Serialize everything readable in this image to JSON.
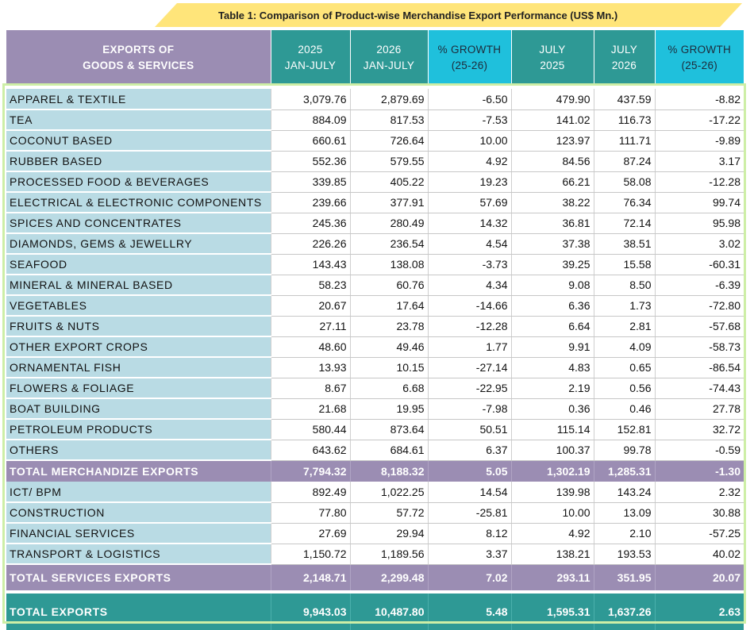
{
  "title": "Table 1: Comparison of Product-wise Merchandise Export Performance (US$ Mn.)",
  "colors": {
    "banner": "#ffe57a",
    "label_header": "#9b8db3",
    "teal": "#2e9995",
    "cyan": "#1fc0dc",
    "row_label": "#b9dbe4",
    "frame": "#cdeea6"
  },
  "headers": {
    "label_line1": "EXPORTS OF",
    "label_line2": "GOODS & SERVICES",
    "c1_line1": "2025",
    "c1_line2": "JAN-JULY",
    "c2_line1": "2026",
    "c2_line2": "JAN-JULY",
    "c3_line1": "% GROWTH",
    "c3_line2": "(25-26)",
    "c4_line1": "JULY",
    "c4_line2": "2025",
    "c5_line1": "JULY",
    "c5_line2": "2026",
    "c6_line1": "% GROWTH",
    "c6_line2": "(25-26)"
  },
  "merchandise": [
    [
      "APPAREL & TEXTILE",
      "3,079.76",
      "2,879.69",
      "-6.50",
      "479.90",
      "437.59",
      "-8.82"
    ],
    [
      "TEA",
      "884.09",
      "817.53",
      "-7.53",
      "141.02",
      "116.73",
      "-17.22"
    ],
    [
      "COCONUT BASED",
      "660.61",
      "726.64",
      "10.00",
      "123.97",
      "111.71",
      "-9.89"
    ],
    [
      "RUBBER BASED",
      "552.36",
      "579.55",
      "4.92",
      "84.56",
      "87.24",
      "3.17"
    ],
    [
      "PROCESSED FOOD & BEVERAGES",
      "339.85",
      "405.22",
      "19.23",
      "66.21",
      "58.08",
      "-12.28"
    ],
    [
      "ELECTRICAL & ELECTRONIC   COMPONENTS",
      "239.66",
      "377.91",
      "57.69",
      "38.22",
      "76.34",
      "99.74"
    ],
    [
      "SPICES AND CONCENTRATES",
      "245.36",
      "280.49",
      "14.32",
      "36.81",
      "72.14",
      "95.98"
    ],
    [
      "DIAMONDS, GEMS & JEWELLRY",
      "226.26",
      "236.54",
      "4.54",
      "37.38",
      "38.51",
      "3.02"
    ],
    [
      "SEAFOOD",
      "143.43",
      "138.08",
      "-3.73",
      "39.25",
      "15.58",
      "-60.31"
    ],
    [
      "MINERAL & MINERAL BASED",
      "58.23",
      "60.76",
      "4.34",
      "9.08",
      "8.50",
      "-6.39"
    ],
    [
      "VEGETABLES",
      "20.67",
      "17.64",
      "-14.66",
      "6.36",
      "1.73",
      "-72.80"
    ],
    [
      "FRUITS & NUTS",
      "27.11",
      "23.78",
      "-12.28",
      "6.64",
      "2.81",
      "-57.68"
    ],
    [
      "OTHER EXPORT CROPS",
      "48.60",
      "49.46",
      "1.77",
      "9.91",
      "4.09",
      "-58.73"
    ],
    [
      "ORNAMENTAL FISH",
      "13.93",
      "10.15",
      "-27.14",
      "4.83",
      "0.65",
      "-86.54"
    ],
    [
      "FLOWERS & FOLIAGE",
      "8.67",
      "6.68",
      "-22.95",
      "2.19",
      "0.56",
      "-74.43"
    ],
    [
      "BOAT BUILDING",
      "21.68",
      "19.95",
      "-7.98",
      "0.36",
      "0.46",
      "27.78"
    ],
    [
      "PETROLEUM PRODUCTS",
      "580.44",
      "873.64",
      "50.51",
      "115.14",
      "152.81",
      "32.72"
    ],
    [
      "OTHERS",
      "643.62",
      "684.61",
      "6.37",
      "100.37",
      "99.78",
      "-0.59"
    ]
  ],
  "merch_total": [
    "TOTAL MERCHANDIZE EXPORTS",
    "7,794.32",
    "8,188.32",
    "5.05",
    "1,302.19",
    "1,285.31",
    "-1.30"
  ],
  "services": [
    [
      "ICT/ BPM",
      "892.49",
      "1,022.25",
      "14.54",
      "139.98",
      "143.24",
      "2.32"
    ],
    [
      "CONSTRUCTION",
      "77.80",
      "57.72",
      "-25.81",
      "10.00",
      "13.09",
      "30.88"
    ],
    [
      "FINANCIAL  SERVICES",
      "27.69",
      "29.94",
      "8.12",
      "4.92",
      "2.10",
      "-57.25"
    ],
    [
      "TRANSPORT  & LOGISTICS",
      "1,150.72",
      "1,189.56",
      "3.37",
      "138.21",
      "193.53",
      "40.02"
    ]
  ],
  "services_total": [
    "TOTAL SERVICES EXPORTS",
    "2,148.71",
    "2,299.48",
    "7.02",
    "293.11",
    "351.95",
    "20.07"
  ],
  "grand_total": [
    "TOTAL EXPORTS",
    "9,943.03",
    "10,487.80",
    "5.48",
    "1,595.31",
    "1,637.26",
    "2.63"
  ]
}
